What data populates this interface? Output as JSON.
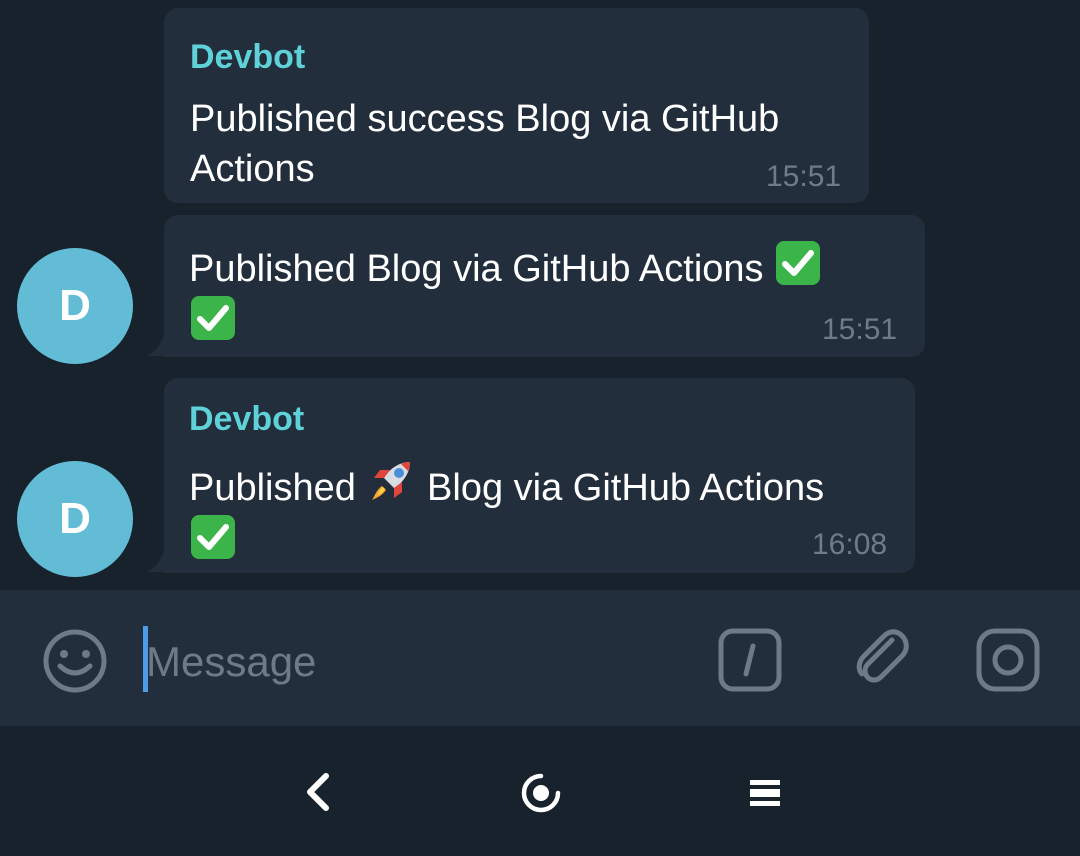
{
  "messages": [
    {
      "sender": "Devbot",
      "text_line1": "Published success Blog via GitHub",
      "text_line2": "Actions",
      "time": "15:51"
    },
    {
      "text_line1": "Published Blog via GitHub Actions",
      "time": "15:51",
      "avatar_letter": "D"
    },
    {
      "sender": "Devbot",
      "text_pre": "Published",
      "text_post": "Blog via GitHub Actions",
      "time": "16:08",
      "avatar_letter": "D"
    }
  ],
  "composer": {
    "placeholder": "Message"
  },
  "icons": {
    "emoji": "smiley-icon",
    "commands": "slash-command-icon",
    "attach": "paperclip-icon",
    "camera": "camera-icon",
    "checkmark": "check-mark-emoji",
    "rocket": "rocket-emoji",
    "nav_back": "back-chevron-icon",
    "nav_home": "home-circle-icon",
    "nav_recents": "recents-icon"
  },
  "colors": {
    "background": "#18222d",
    "bubble": "#232e3c",
    "sender": "#5ed2d8",
    "avatar": "#62bcd6",
    "accent": "#4c9ce8"
  }
}
